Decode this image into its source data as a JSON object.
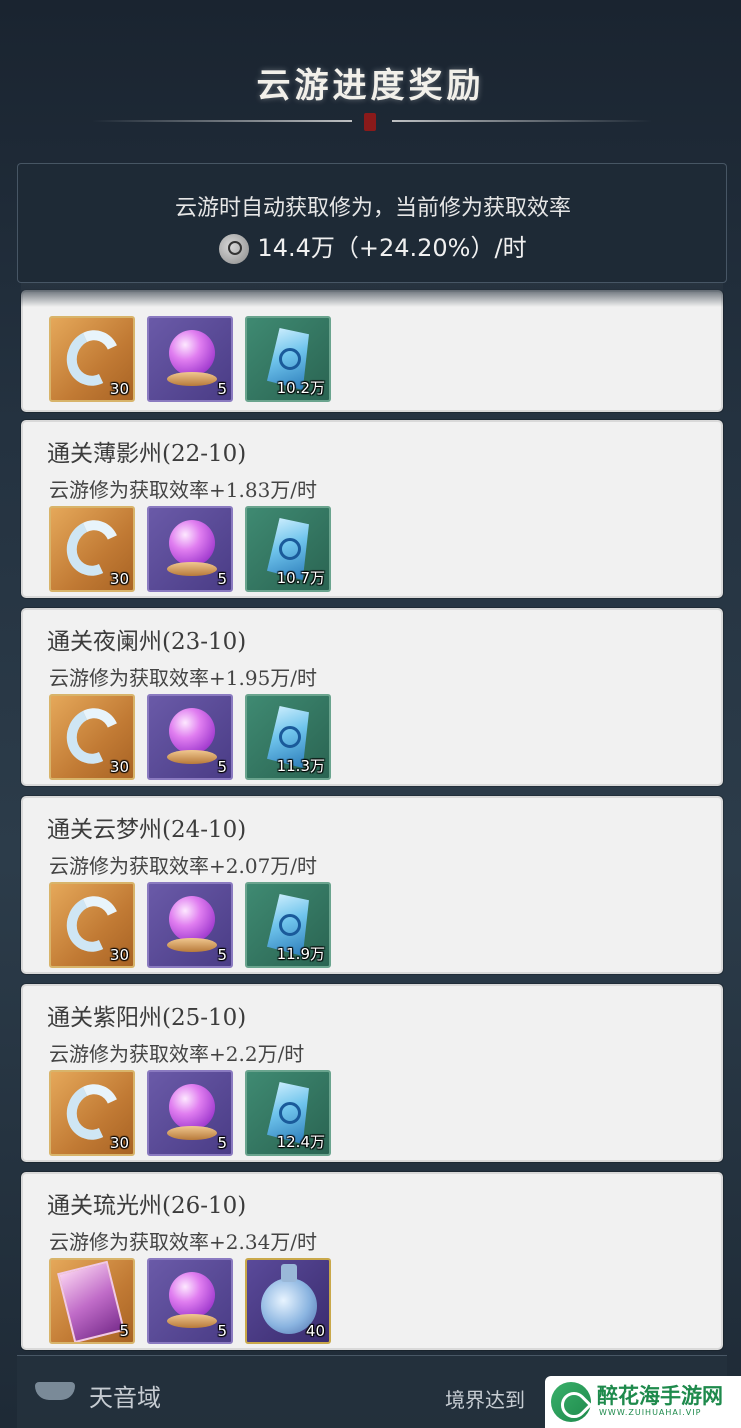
{
  "header": {
    "title": "云游进度奖励"
  },
  "info": {
    "line1": "云游时自动获取修为，当前修为获取效率",
    "rate_value": "14.4万（+24.20%）/时",
    "icon": "cultivation-icon"
  },
  "rewards": [
    {
      "title": "",
      "rate": "",
      "items": [
        {
          "icon": "crescent-hook-icon",
          "count": "30"
        },
        {
          "icon": "purple-orb-icon",
          "count": "5"
        },
        {
          "icon": "blue-crystal-icon",
          "count": "10.2万"
        }
      ]
    },
    {
      "title": "通关薄影州(22-10)",
      "rate": "云游修为获取效率+1.83万/时",
      "items": [
        {
          "icon": "crescent-hook-icon",
          "count": "30"
        },
        {
          "icon": "purple-orb-icon",
          "count": "5"
        },
        {
          "icon": "blue-crystal-icon",
          "count": "10.7万"
        }
      ]
    },
    {
      "title": "通关夜阑州(23-10)",
      "rate": "云游修为获取效率+1.95万/时",
      "items": [
        {
          "icon": "crescent-hook-icon",
          "count": "30"
        },
        {
          "icon": "purple-orb-icon",
          "count": "5"
        },
        {
          "icon": "blue-crystal-icon",
          "count": "11.3万"
        }
      ]
    },
    {
      "title": "通关云梦州(24-10)",
      "rate": "云游修为获取效率+2.07万/时",
      "items": [
        {
          "icon": "crescent-hook-icon",
          "count": "30"
        },
        {
          "icon": "purple-orb-icon",
          "count": "5"
        },
        {
          "icon": "blue-crystal-icon",
          "count": "11.9万"
        }
      ]
    },
    {
      "title": "通关紫阳州(25-10)",
      "rate": "云游修为获取效率+2.2万/时",
      "items": [
        {
          "icon": "crescent-hook-icon",
          "count": "30"
        },
        {
          "icon": "purple-orb-icon",
          "count": "5"
        },
        {
          "icon": "blue-crystal-icon",
          "count": "12.4万"
        }
      ]
    },
    {
      "title": "通关琉光州(26-10)",
      "rate": "云游修为获取效率+2.34万/时",
      "items": [
        {
          "icon": "talisman-card-icon",
          "count": "5"
        },
        {
          "icon": "purple-orb-icon",
          "count": "5"
        },
        {
          "icon": "spirit-flask-icon",
          "count": "40"
        }
      ]
    }
  ],
  "bottom": {
    "left_label": "天音域",
    "right_label": "境界达到"
  },
  "watermark": {
    "text": "醉花海手游网",
    "sub": "WWW.ZUIHUAHAI.VIP"
  },
  "colors": {
    "background": "#243240",
    "card": "#f1f1f1",
    "title_text": "#f2f0ea"
  }
}
